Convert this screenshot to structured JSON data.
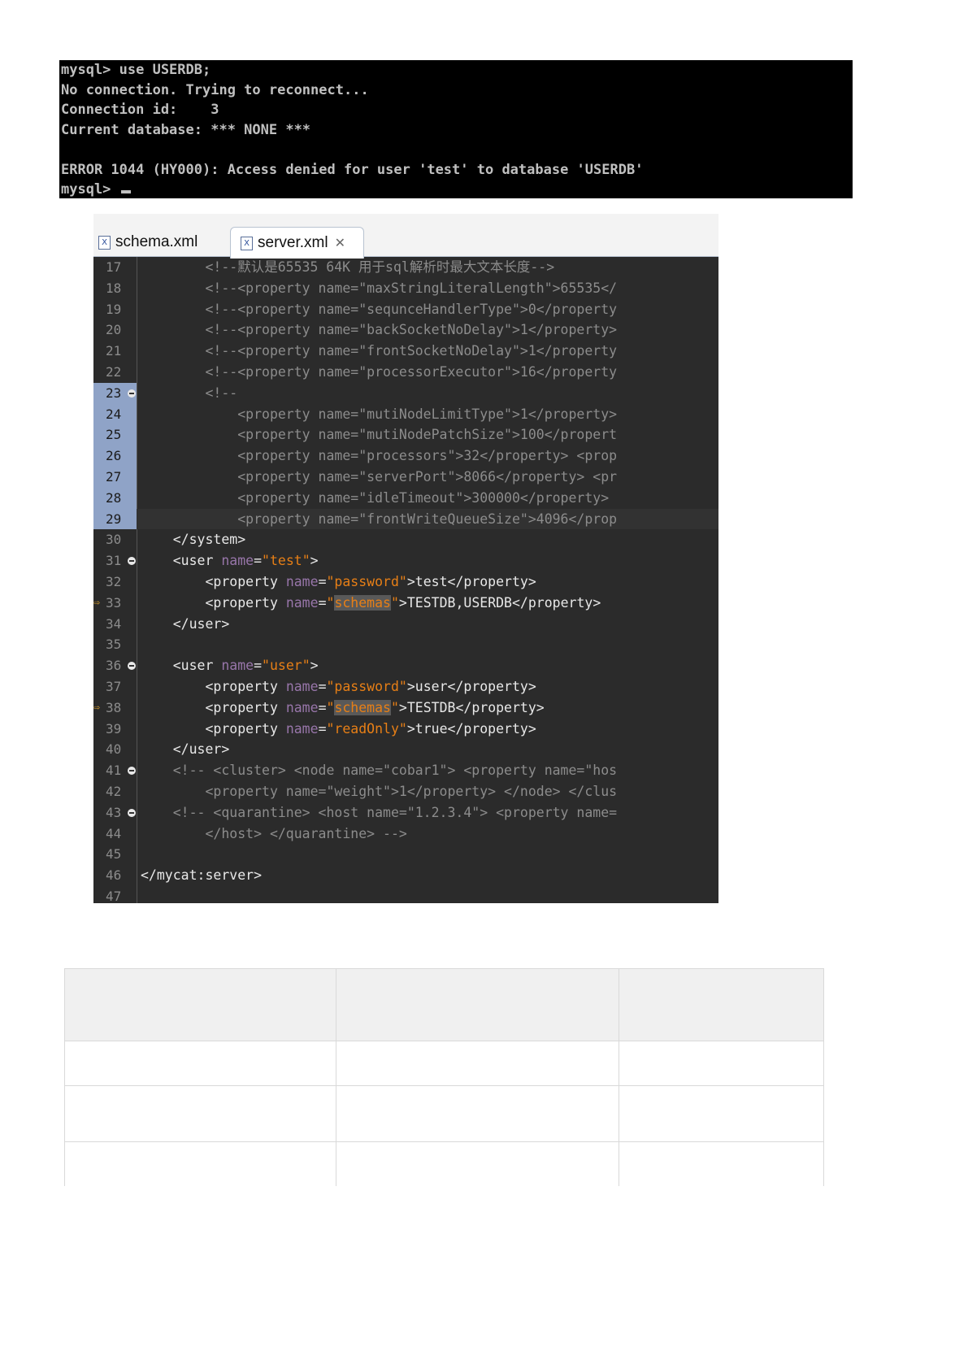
{
  "terminal": {
    "lines": [
      "mysql> use USERDB;",
      "No connection. Trying to reconnect...",
      "Connection id:    3",
      "Current database: *** NONE ***",
      "",
      "ERROR 1044 (HY000): Access denied for user 'test' to database 'USERDB'",
      "mysql> "
    ]
  },
  "editor": {
    "tabs": [
      {
        "label": "schema.xml",
        "icon": "xml-file-icon",
        "active": false
      },
      {
        "label": "server.xml",
        "icon": "xml-file-icon",
        "active": true
      }
    ],
    "lines": [
      {
        "n": "17",
        "segments": [
          [
            "c-comment",
            "        <!--默认是65535 64K 用于sql解析时最大文本长度-->"
          ]
        ]
      },
      {
        "n": "18",
        "segments": [
          [
            "c-comment",
            "        <!--<property name=\"maxStringLiteralLength\">65535</"
          ]
        ]
      },
      {
        "n": "19",
        "segments": [
          [
            "c-comment",
            "        <!--<property name=\"sequnceHandlerType\">0</property"
          ]
        ]
      },
      {
        "n": "20",
        "segments": [
          [
            "c-comment",
            "        <!--<property name=\"backSocketNoDelay\">1</property>"
          ]
        ]
      },
      {
        "n": "21",
        "segments": [
          [
            "c-comment",
            "        <!--<property name=\"frontSocketNoDelay\">1</property"
          ]
        ]
      },
      {
        "n": "22",
        "segments": [
          [
            "c-comment",
            "        <!--<property name=\"processorExecutor\">16</property"
          ]
        ]
      },
      {
        "n": "23",
        "fold": true,
        "marked": true,
        "segments": [
          [
            "c-comment",
            "        <!--"
          ]
        ]
      },
      {
        "n": "24",
        "marked": true,
        "segments": [
          [
            "c-comment",
            "            <property name=\"mutiNodeLimitType\">1</property>"
          ]
        ]
      },
      {
        "n": "25",
        "marked": true,
        "segments": [
          [
            "c-comment",
            "            <property name=\"mutiNodePatchSize\">100</propert"
          ]
        ]
      },
      {
        "n": "26",
        "marked": true,
        "segments": [
          [
            "c-comment",
            "            <property name=\"processors\">32</property> <prop"
          ]
        ]
      },
      {
        "n": "27",
        "marked": true,
        "segments": [
          [
            "c-comment",
            "            <property name=\"serverPort\">8066</property> <pr"
          ]
        ]
      },
      {
        "n": "28",
        "marked": true,
        "segments": [
          [
            "c-comment",
            "            <property name=\"idleTimeout\">300000</property> "
          ]
        ]
      },
      {
        "n": "29",
        "marked": true,
        "current": true,
        "segments": [
          [
            "c-comment",
            "            <property name=\"frontWriteQueueSize\">4096</prop"
          ]
        ]
      },
      {
        "n": "30",
        "segments": [
          [
            "c-tag",
            "    </system>"
          ]
        ]
      },
      {
        "n": "31",
        "fold": true,
        "segments": [
          [
            "c-tag",
            "    <user "
          ],
          [
            "c-attr",
            "name"
          ],
          [
            "c-tag",
            "="
          ],
          [
            "c-str",
            "\"test\""
          ],
          [
            "c-tag",
            ">"
          ]
        ]
      },
      {
        "n": "32",
        "segments": [
          [
            "c-tag",
            "        <property "
          ],
          [
            "c-attr",
            "name"
          ],
          [
            "c-tag",
            "="
          ],
          [
            "c-str",
            "\"password\""
          ],
          [
            "c-tag",
            ">test</property>"
          ]
        ]
      },
      {
        "n": "33",
        "arrow": true,
        "segments": [
          [
            "c-tag",
            "        <property "
          ],
          [
            "c-attr",
            "name"
          ],
          [
            "c-tag",
            "="
          ],
          [
            "c-str",
            "\""
          ],
          [
            "c-hl",
            "schemas"
          ],
          [
            "c-str",
            "\""
          ],
          [
            "c-tag",
            ">TESTDB,USERDB</property>"
          ]
        ]
      },
      {
        "n": "34",
        "segments": [
          [
            "c-tag",
            "    </user>"
          ]
        ]
      },
      {
        "n": "35",
        "segments": [
          [
            "c-tag",
            ""
          ]
        ]
      },
      {
        "n": "36",
        "fold": true,
        "segments": [
          [
            "c-tag",
            "    <user "
          ],
          [
            "c-attr",
            "name"
          ],
          [
            "c-tag",
            "="
          ],
          [
            "c-str",
            "\"user\""
          ],
          [
            "c-tag",
            ">"
          ]
        ]
      },
      {
        "n": "37",
        "segments": [
          [
            "c-tag",
            "        <property "
          ],
          [
            "c-attr",
            "name"
          ],
          [
            "c-tag",
            "="
          ],
          [
            "c-str",
            "\"password\""
          ],
          [
            "c-tag",
            ">user</property>"
          ]
        ]
      },
      {
        "n": "38",
        "arrow": true,
        "segments": [
          [
            "c-tag",
            "        <property "
          ],
          [
            "c-attr",
            "name"
          ],
          [
            "c-tag",
            "="
          ],
          [
            "c-str",
            "\""
          ],
          [
            "c-hl",
            "schemas"
          ],
          [
            "c-str",
            "\""
          ],
          [
            "c-tag",
            ">TESTDB</property>"
          ]
        ]
      },
      {
        "n": "39",
        "segments": [
          [
            "c-tag",
            "        <property "
          ],
          [
            "c-attr",
            "name"
          ],
          [
            "c-tag",
            "="
          ],
          [
            "c-str",
            "\"readOnly\""
          ],
          [
            "c-tag",
            ">true</property>"
          ]
        ]
      },
      {
        "n": "40",
        "segments": [
          [
            "c-tag",
            "    </user>"
          ]
        ]
      },
      {
        "n": "41",
        "fold": true,
        "segments": [
          [
            "c-comment",
            "    <!-- <cluster> <node name=\"cobar1\"> <property name=\"hos"
          ]
        ]
      },
      {
        "n": "42",
        "segments": [
          [
            "c-comment",
            "        <property name=\"weight\">1</property> </node> </clus"
          ]
        ]
      },
      {
        "n": "43",
        "fold": true,
        "segments": [
          [
            "c-comment",
            "    <!-- <quarantine> <host name=\"1.2.3.4\"> <property name="
          ]
        ]
      },
      {
        "n": "44",
        "segments": [
          [
            "c-comment",
            "        </host> </quarantine> -->"
          ]
        ]
      },
      {
        "n": "45",
        "segments": [
          [
            "c-tag",
            ""
          ]
        ]
      },
      {
        "n": "46",
        "segments": [
          [
            "c-tag",
            "</mycat:server>"
          ]
        ]
      },
      {
        "n": "47",
        "segments": [
          [
            "c-tag",
            ""
          ]
        ]
      }
    ]
  },
  "table": {
    "rows": [
      [
        "",
        "",
        ""
      ],
      [
        "",
        "",
        ""
      ],
      [
        "",
        "",
        ""
      ],
      [
        "",
        "",
        ""
      ]
    ]
  }
}
